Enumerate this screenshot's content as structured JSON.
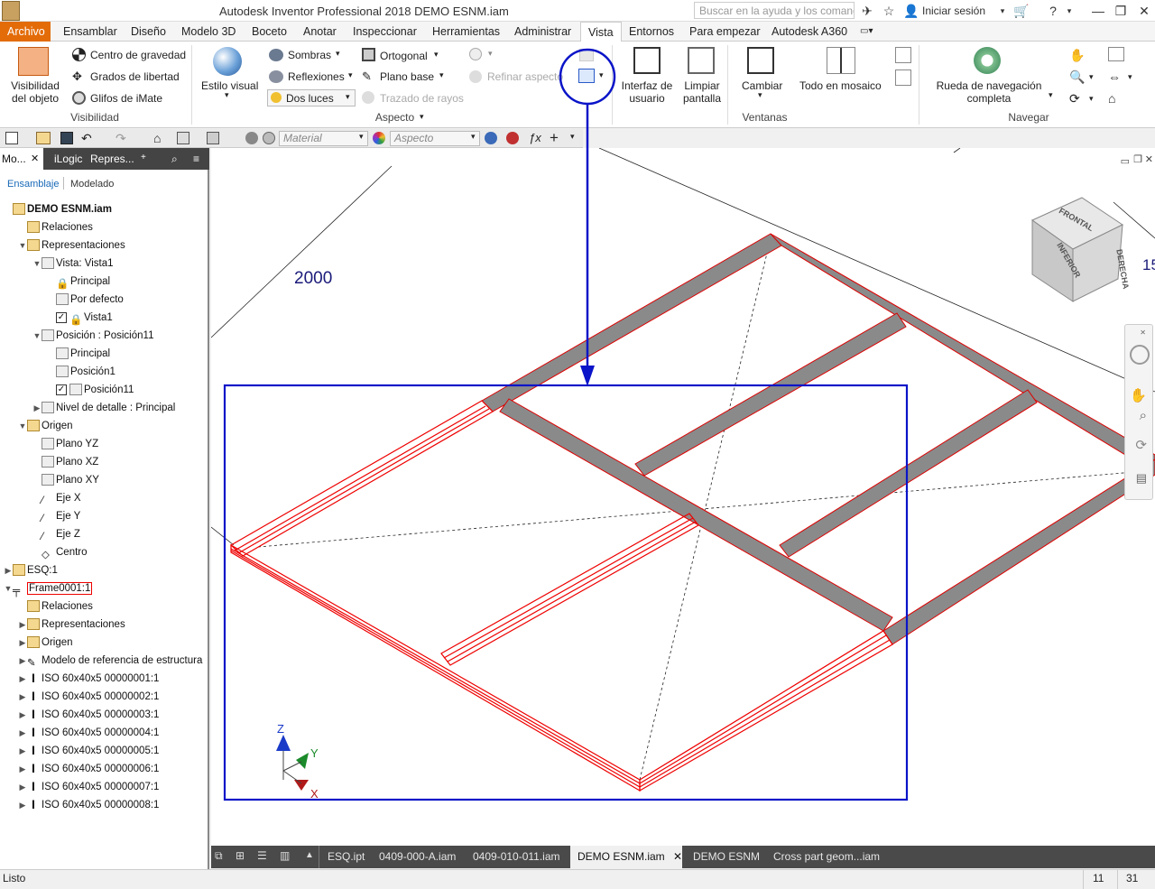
{
  "app": {
    "title": "Autodesk Inventor Professional 2018    DEMO ESNM.iam",
    "help_search_placeholder": "Buscar en la ayuda y los comandos...",
    "signin_label": "Iniciar sesión"
  },
  "menu_tabs": [
    "Archivo",
    "Ensamblar",
    "Diseño",
    "Modelo 3D",
    "Boceto",
    "Anotar",
    "Inspeccionar",
    "Herramientas",
    "Administrar",
    "Vista",
    "Entornos",
    "Para empezar",
    "Autodesk A360"
  ],
  "active_tab": "Vista",
  "ribbon": {
    "visibilidad": {
      "group_label": "Visibilidad",
      "visibility_button": "Visibilidad del objeto",
      "items": [
        "Centro de gravedad",
        "Grados de libertad",
        "Glifos de iMate"
      ]
    },
    "aspecto": {
      "group_label": "Aspecto",
      "estilo_visual": "Estilo visual",
      "sombras": "Sombras",
      "reflexiones": "Reflexiones",
      "dos_luces": "Dos luces",
      "ortogonal": "Ortogonal",
      "plano_base": "Plano base",
      "trazado_rayos": "Trazado de rayos",
      "refinar_aspecto": "Refinar aspecto"
    },
    "ventanas": {
      "group_label": "Ventanas",
      "interfaz": "Interfaz de usuario",
      "limpiar": "Limpiar pantalla",
      "cambiar": "Cambiar",
      "mosaico": "Todo en mosaico"
    },
    "navegar": {
      "group_label": "Navegar",
      "rueda": "Rueda de navegación completa"
    }
  },
  "qat": {
    "material_placeholder": "Material",
    "aspecto_placeholder": "Aspecto"
  },
  "browser": {
    "tabs": [
      "Mo...",
      "iLogic",
      "Repres..."
    ],
    "subtabs": [
      "Ensamblaje",
      "Modelado"
    ],
    "tree": [
      {
        "label": "DEMO ESNM.iam",
        "level": 0,
        "icon": "assembly-icon",
        "bold": true
      },
      {
        "label": "Relaciones",
        "level": 1,
        "icon": "folder-icon"
      },
      {
        "label": "Representaciones",
        "level": 1,
        "icon": "representations-icon",
        "twisty": "open"
      },
      {
        "label": "Vista: Vista1",
        "level": 2,
        "icon": "view-rep-icon",
        "twisty": "open"
      },
      {
        "label": "Principal",
        "level": 3,
        "icon": "lock-icon"
      },
      {
        "label": "Por defecto",
        "level": 3,
        "icon": "view-rep-icon"
      },
      {
        "label": "Vista1",
        "level": 3,
        "icon": "lock-icon",
        "checked": true
      },
      {
        "label": "Posición : Posición11",
        "level": 2,
        "icon": "position-rep-icon",
        "twisty": "open"
      },
      {
        "label": "Principal",
        "level": 3,
        "icon": "position-rep-icon"
      },
      {
        "label": "Posición1",
        "level": 3,
        "icon": "position-rep-icon"
      },
      {
        "label": "Posición11",
        "level": 3,
        "icon": "position-rep-icon",
        "checked": true
      },
      {
        "label": "Nivel de detalle : Principal",
        "level": 2,
        "icon": "lod-icon",
        "twisty": "closed"
      },
      {
        "label": "Origen",
        "level": 1,
        "icon": "folder-icon",
        "twisty": "open"
      },
      {
        "label": "Plano YZ",
        "level": 2,
        "icon": "plane-icon"
      },
      {
        "label": "Plano XZ",
        "level": 2,
        "icon": "plane-icon"
      },
      {
        "label": "Plano XY",
        "level": 2,
        "icon": "plane-icon"
      },
      {
        "label": "Eje X",
        "level": 2,
        "icon": "axis-icon"
      },
      {
        "label": "Eje Y",
        "level": 2,
        "icon": "axis-icon"
      },
      {
        "label": "Eje Z",
        "level": 2,
        "icon": "axis-icon"
      },
      {
        "label": "Centro",
        "level": 2,
        "icon": "point-icon"
      },
      {
        "label": "ESQ:1",
        "level": 0,
        "icon": "sketch-part-icon",
        "twisty": "closed"
      },
      {
        "label": "Frame0001:1",
        "level": 0,
        "icon": "frame-icon",
        "twisty": "open",
        "selected": true
      },
      {
        "label": "Relaciones",
        "level": 1,
        "icon": "folder-icon"
      },
      {
        "label": "Representaciones",
        "level": 1,
        "icon": "representations-icon",
        "twisty": "closed"
      },
      {
        "label": "Origen",
        "level": 1,
        "icon": "folder-icon",
        "twisty": "closed"
      },
      {
        "label": "Modelo de referencia de estructura",
        "level": 1,
        "icon": "reference-model-icon",
        "twisty": "closed"
      },
      {
        "label": "ISO 60x40x5 00000001:1",
        "level": 1,
        "icon": "beam-icon",
        "twisty": "closed"
      },
      {
        "label": "ISO 60x40x5 00000002:1",
        "level": 1,
        "icon": "beam-icon",
        "twisty": "closed"
      },
      {
        "label": "ISO 60x40x5 00000003:1",
        "level": 1,
        "icon": "beam-icon",
        "twisty": "closed"
      },
      {
        "label": "ISO 60x40x5 00000004:1",
        "level": 1,
        "icon": "beam-icon",
        "twisty": "closed"
      },
      {
        "label": "ISO 60x40x5 00000005:1",
        "level": 1,
        "icon": "beam-icon",
        "twisty": "closed"
      },
      {
        "label": "ISO 60x40x5 00000006:1",
        "level": 1,
        "icon": "beam-icon",
        "twisty": "closed"
      },
      {
        "label": "ISO 60x40x5 00000007:1",
        "level": 1,
        "icon": "beam-icon",
        "twisty": "closed"
      },
      {
        "label": "ISO 60x40x5 00000008:1",
        "level": 1,
        "icon": "beam-icon",
        "twisty": "closed"
      }
    ]
  },
  "viewport": {
    "dimension_label": "2000",
    "dimension_label_right": "15",
    "viewcube": {
      "top": "FRONTAL",
      "right": "DERECHA",
      "left": "INFERIOR"
    },
    "triad": {
      "z": "Z",
      "y": "Y",
      "x": "X"
    }
  },
  "doc_tabs": [
    "ESQ.ipt",
    "0409-000-A.iam",
    "0409-010-011.iam",
    "DEMO ESNM.iam",
    "DEMO ESNM",
    "Cross part geom...iam"
  ],
  "active_doc_tab": "DEMO ESNM.iam",
  "status": {
    "text": "Listo",
    "count_a": "11",
    "count_b": "31"
  },
  "colors": {
    "accent": "#e36c09",
    "annotation": "#0a14c8",
    "selection": "#e00000"
  }
}
